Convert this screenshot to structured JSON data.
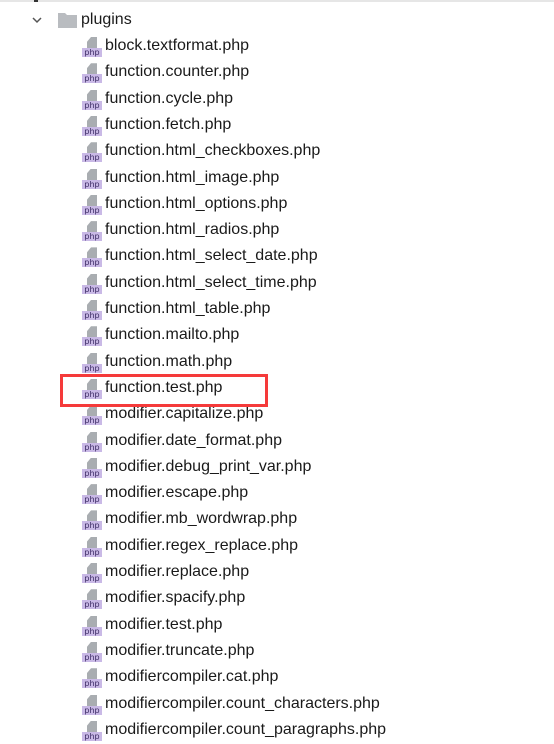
{
  "folder": {
    "name": "plugins",
    "expanded": true
  },
  "files": [
    "block.textformat.php",
    "function.counter.php",
    "function.cycle.php",
    "function.fetch.php",
    "function.html_checkboxes.php",
    "function.html_image.php",
    "function.html_options.php",
    "function.html_radios.php",
    "function.html_select_date.php",
    "function.html_select_time.php",
    "function.html_table.php",
    "function.mailto.php",
    "function.math.php",
    "function.test.php",
    "modifier.capitalize.php",
    "modifier.date_format.php",
    "modifier.debug_print_var.php",
    "modifier.escape.php",
    "modifier.mb_wordwrap.php",
    "modifier.regex_replace.php",
    "modifier.replace.php",
    "modifier.spacify.php",
    "modifier.test.php",
    "modifier.truncate.php",
    "modifiercompiler.cat.php",
    "modifiercompiler.count_characters.php",
    "modifiercompiler.count_paragraphs.php"
  ],
  "file_icon_label": "php",
  "highlighted_file": "function.test.php",
  "colors": {
    "highlight": "#f53a3a",
    "php_tag": "#c9b9e6"
  }
}
